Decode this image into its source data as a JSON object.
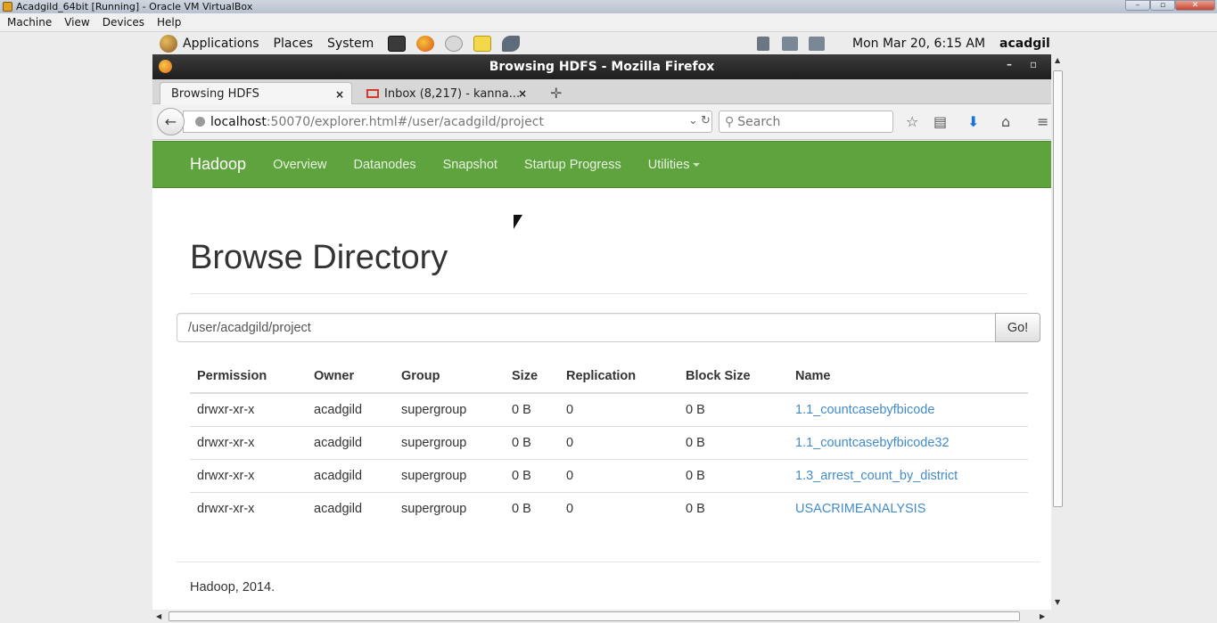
{
  "host": {
    "title": "Acadgild_64bit [Running] - Oracle VM VirtualBox",
    "menu": [
      "Machine",
      "View",
      "Devices",
      "Help"
    ]
  },
  "panel": {
    "menus": [
      "Applications",
      "Places",
      "System"
    ],
    "clock": "Mon Mar 20,  6:15 AM",
    "user": "acadgil"
  },
  "firefox": {
    "window_title": "Browsing HDFS - Mozilla Firefox",
    "tabs": [
      {
        "label": "Browsing HDFS",
        "close": "×"
      },
      {
        "label": "Inbox (8,217) - kanna...",
        "close": "×"
      }
    ],
    "url_host": "localhost",
    "url_rest": ":50070/explorer.html#/user/acadgild/project",
    "search_placeholder": "Search"
  },
  "hadoop": {
    "brand": "Hadoop",
    "nav": [
      "Overview",
      "Datanodes",
      "Snapshot",
      "Startup Progress",
      "Utilities"
    ],
    "page_title": "Browse Directory",
    "path_value": "/user/acadgild/project",
    "go_label": "Go!",
    "columns": [
      "Permission",
      "Owner",
      "Group",
      "Size",
      "Replication",
      "Block Size",
      "Name"
    ],
    "rows": [
      {
        "permission": "drwxr-xr-x",
        "owner": "acadgild",
        "group": "supergroup",
        "size": "0 B",
        "replication": "0",
        "block_size": "0 B",
        "name": "1.1_countcasebyfbicode"
      },
      {
        "permission": "drwxr-xr-x",
        "owner": "acadgild",
        "group": "supergroup",
        "size": "0 B",
        "replication": "0",
        "block_size": "0 B",
        "name": "1.1_countcasebyfbicode32"
      },
      {
        "permission": "drwxr-xr-x",
        "owner": "acadgild",
        "group": "supergroup",
        "size": "0 B",
        "replication": "0",
        "block_size": "0 B",
        "name": "1.3_arrest_count_by_district"
      },
      {
        "permission": "drwxr-xr-x",
        "owner": "acadgild",
        "group": "supergroup",
        "size": "0 B",
        "replication": "0",
        "block_size": "0 B",
        "name": "USACRIMEANALYSIS"
      }
    ],
    "footer": "Hadoop, 2014."
  },
  "colors": {
    "hadoop_green": "#5fa33e",
    "link_blue": "#428bca"
  }
}
